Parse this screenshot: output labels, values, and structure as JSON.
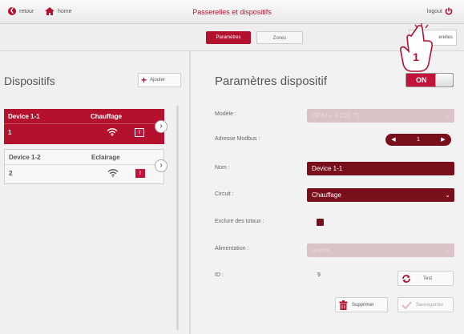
{
  "topbar": {
    "back_label": "retour",
    "home_label": "home",
    "title": "Passerelles et dispositifs",
    "logout_label": "logout"
  },
  "tabs": [
    {
      "label": "Paramètres",
      "active": true
    },
    {
      "label": "Zones",
      "active": false
    }
  ],
  "passerelles_button": "erelles",
  "left": {
    "title": "Dispositifs",
    "add_label": "Ajouter",
    "devices": [
      {
        "name": "Device 1-1",
        "type": "Chauffage",
        "id": "1",
        "badge": "I",
        "selected": true
      },
      {
        "name": "Device 1-2",
        "type": "Eclairage",
        "id": "2",
        "badge": "I",
        "selected": false
      }
    ]
  },
  "right": {
    "title": "Paramètres dispositif",
    "toggle_label": "ON",
    "fields": {
      "modele": {
        "label": "Modèle :",
        "value": "DPX³ + 4 210 75"
      },
      "modbus": {
        "label": "Adresse Modbus :",
        "value": "1"
      },
      "nom": {
        "label": "Nom :",
        "value": "Device 1-1"
      },
      "circuit": {
        "label": "Circuit :",
        "value": "Chauffage"
      },
      "exclure": {
        "label": "Exclure des totaux :",
        "checked": true
      },
      "alimentation": {
        "label": "Alimentation :",
        "value": "amont"
      },
      "id": {
        "label": "ID :",
        "value": "9"
      }
    },
    "buttons": {
      "test": "Test",
      "supprimer": "Supprimer",
      "sauvegarder": "Sauvegarder"
    }
  },
  "annotation": {
    "number": "1"
  },
  "colors": {
    "accent": "#b4112e",
    "dark": "#7a0f1c",
    "disabled": "#d9c3c7"
  }
}
